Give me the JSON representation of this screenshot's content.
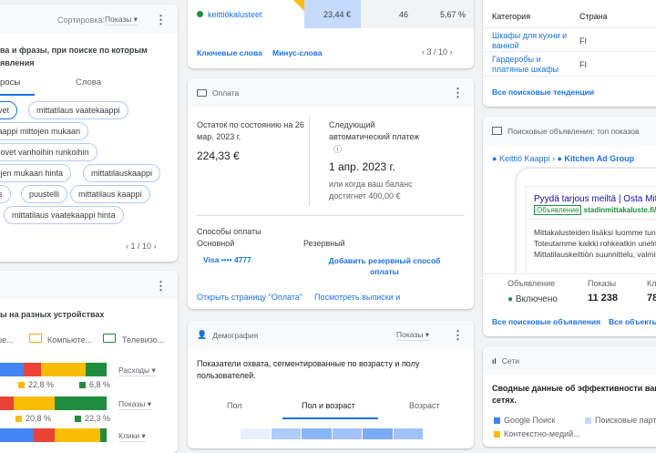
{
  "search_terms": {
    "sort_label": "Сортировка:",
    "sort_value": "Показы",
    "title": "ва и фразы, при поиске по которым\nявления",
    "tabs": [
      "росы",
      "Слова"
    ],
    "chips": [
      "ovet",
      "mittatilaus vaatekaappi",
      "kaappi mittojen mukaan",
      "n ovet vanhoihin runkoihin",
      "tojen mukaan hinta",
      "mittatilauskaappi",
      "us",
      "puustelli",
      "mittatilaus kaappi",
      "mittatilaus vaatekaappi hinta"
    ],
    "pager": "1 / 10"
  },
  "devices": {
    "title": "ы на разных устройствах",
    "legend": [
      "аше...",
      "Компьюте...",
      "Телевизо..."
    ],
    "rows": [
      {
        "metric": "Расходы",
        "labels": [
          "22,8 %",
          "6,8 %"
        ]
      },
      {
        "metric": "Показы",
        "labels": [
          "20,8 %",
          "22,3 %"
        ]
      },
      {
        "metric": "Клики",
        "labels": []
      }
    ]
  },
  "keywords": {
    "keyword": "keittiökalusteet",
    "cost": "23,44 €",
    "impressions": "46",
    "ctr": "5,67 %",
    "links": [
      "Ключевые слова",
      "Минус-слова"
    ],
    "pager": "3 / 10"
  },
  "billing": {
    "title": "Оплата",
    "balance_label": "Остаток по состоянию на 26 мар. 2023 г.",
    "balance": "224,33 €",
    "next_label": "Следующий автоматический платеж",
    "next_date": "1 апр. 2023 г.",
    "next_note": "или когда ваш баланс достигнет 400,00 €",
    "methods_title": "Способы оплаты",
    "primary_label": "Основной",
    "backup_label": "Резервный",
    "card": "Visa •••• 4777",
    "add_backup": "Добавить резервный способ оплаты",
    "links": [
      "Открыть страницу \"Оплата\"",
      "Посмотреть выписки и"
    ]
  },
  "demographics": {
    "title": "Демография",
    "metric": "Показы",
    "description": "Показатели охвата, сегментированные по возрасту и полу пользователей.",
    "tabs": [
      "Пол",
      "Пол и возраст",
      "Возраст"
    ]
  },
  "trends": {
    "headers": [
      "Категория",
      "Страна"
    ],
    "rows": [
      [
        "Шкафы для кухни и ванной",
        "FI"
      ],
      [
        "Гардеробы и платяные шкафы",
        "FI"
      ]
    ],
    "link": "Все поисковые тенденции"
  },
  "top_ads": {
    "title": "Поисковые объявления: топ показов",
    "breadcrumb": [
      "Keittiö Kaappi",
      "Kitchen Ad Group"
    ],
    "ad_title": "Pyydä tarjous meiltä | Osta Mitt Mittatilauskeittiön Valmistus",
    "ad_badge": "Объявление",
    "ad_url": "stadinmittakaluste.fi/m",
    "ad_text": "Mittakalusteiden lisäksi luomme tunn Toteutamme kaikki rohkeatkin unelm Mittatilauskeittiön suunnittelu, valmis",
    "stats_labels": [
      "Объявление",
      "Показы",
      "Кл"
    ],
    "status": "Включено",
    "impressions": "11 238",
    "clicks": "78",
    "links": [
      "Все поисковые объявления",
      "Все объекты"
    ]
  },
  "networks": {
    "title": "Сети",
    "description": "Сводные данные об эффективности ваш сетях.",
    "legend": [
      "Google Поиск",
      "Поисковые парт",
      "Контекстно-медий..."
    ]
  }
}
